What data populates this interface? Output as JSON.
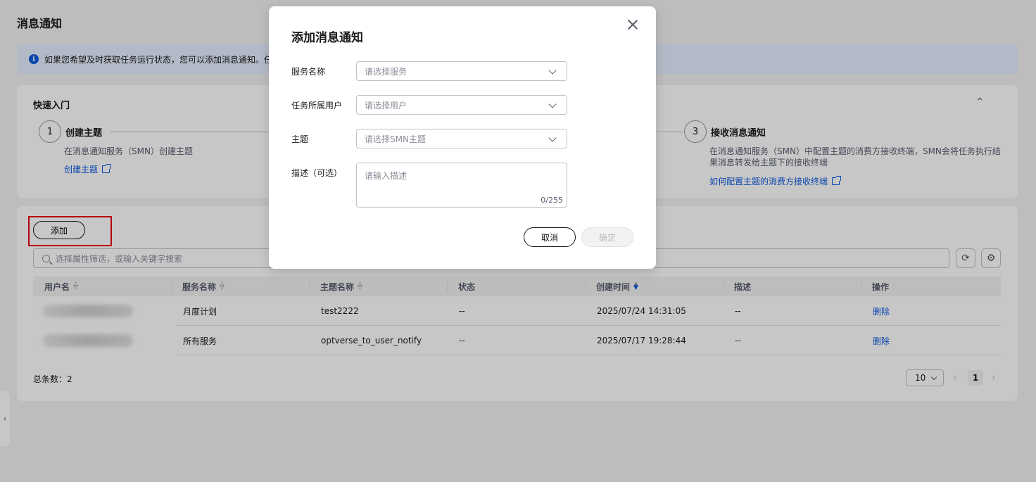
{
  "page": {
    "title": "消息通知"
  },
  "info": {
    "text": "如果您希望及时获取任务运行状态，您可以添加消息通知。任"
  },
  "quick_start": {
    "title": "快速入门",
    "steps": [
      {
        "num": "1",
        "title": "创建主题",
        "desc": "在消息通知服务（SMN）创建主题",
        "link": "创建主题"
      },
      {
        "num": "3",
        "title": "接收消息通知",
        "desc": "在消息通知服务（SMN）中配置主题的消费方接收终端，SMN会将任务执行结果消息转发给主题下的接收终端",
        "link": "如何配置主题的消费方接收终端"
      }
    ]
  },
  "toolbar": {
    "add_label": "添加"
  },
  "search": {
    "placeholder": "选择属性筛选，或输入关键字搜索"
  },
  "table": {
    "headers": [
      "用户名",
      "服务名称",
      "主题名称",
      "状态",
      "创建时间",
      "描述",
      "操作"
    ],
    "rows": [
      {
        "service": "月度计划",
        "topic": "test2222",
        "status": "--",
        "created": "2025/07/24 14:31:05",
        "desc": "--",
        "action": "删除"
      },
      {
        "service": "所有服务",
        "topic": "optverse_to_user_notify",
        "status": "--",
        "created": "2025/07/17 19:28:44",
        "desc": "--",
        "action": "删除"
      }
    ]
  },
  "footer": {
    "total": "总条数：2",
    "page_size": "10",
    "current_page": "1"
  },
  "dialog": {
    "title": "添加消息通知",
    "fields": [
      {
        "label": "服务名称",
        "placeholder": "请选择服务"
      },
      {
        "label": "任务所属用户",
        "placeholder": "请选择用户"
      },
      {
        "label": "主题",
        "placeholder": "请选择SMN主题"
      }
    ],
    "desc_label": "描述（可选）",
    "desc_placeholder": "请输入描述",
    "desc_counter": "0/255",
    "cancel_label": "取消",
    "ok_label": "确定"
  },
  "colors": {
    "accent": "#0a59e0",
    "highlight": "#e60012"
  }
}
